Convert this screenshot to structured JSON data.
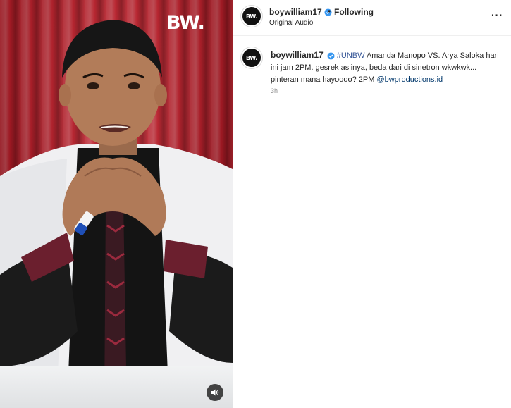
{
  "post": {
    "username": "boywilliam17",
    "separator": "•",
    "follow_status": "Following",
    "audio": "Original Audio",
    "more": "···",
    "avatar_text": "BW.",
    "watermark": "BW."
  },
  "caption": {
    "username": "boywilliam17",
    "hashtag": "#UNBW",
    "body": "Amanda Manopo VS. Arya Saloka hari ini jam 2PM. gesrek aslinya, beda dari di sinetron wkwkwk... pinteran mana hayoooo? 2PM",
    "mention": "@bwproductions.id",
    "time": "3h"
  },
  "colors": {
    "verified": "#3897f0",
    "curtain": "#c01724",
    "link": "#00376b"
  }
}
